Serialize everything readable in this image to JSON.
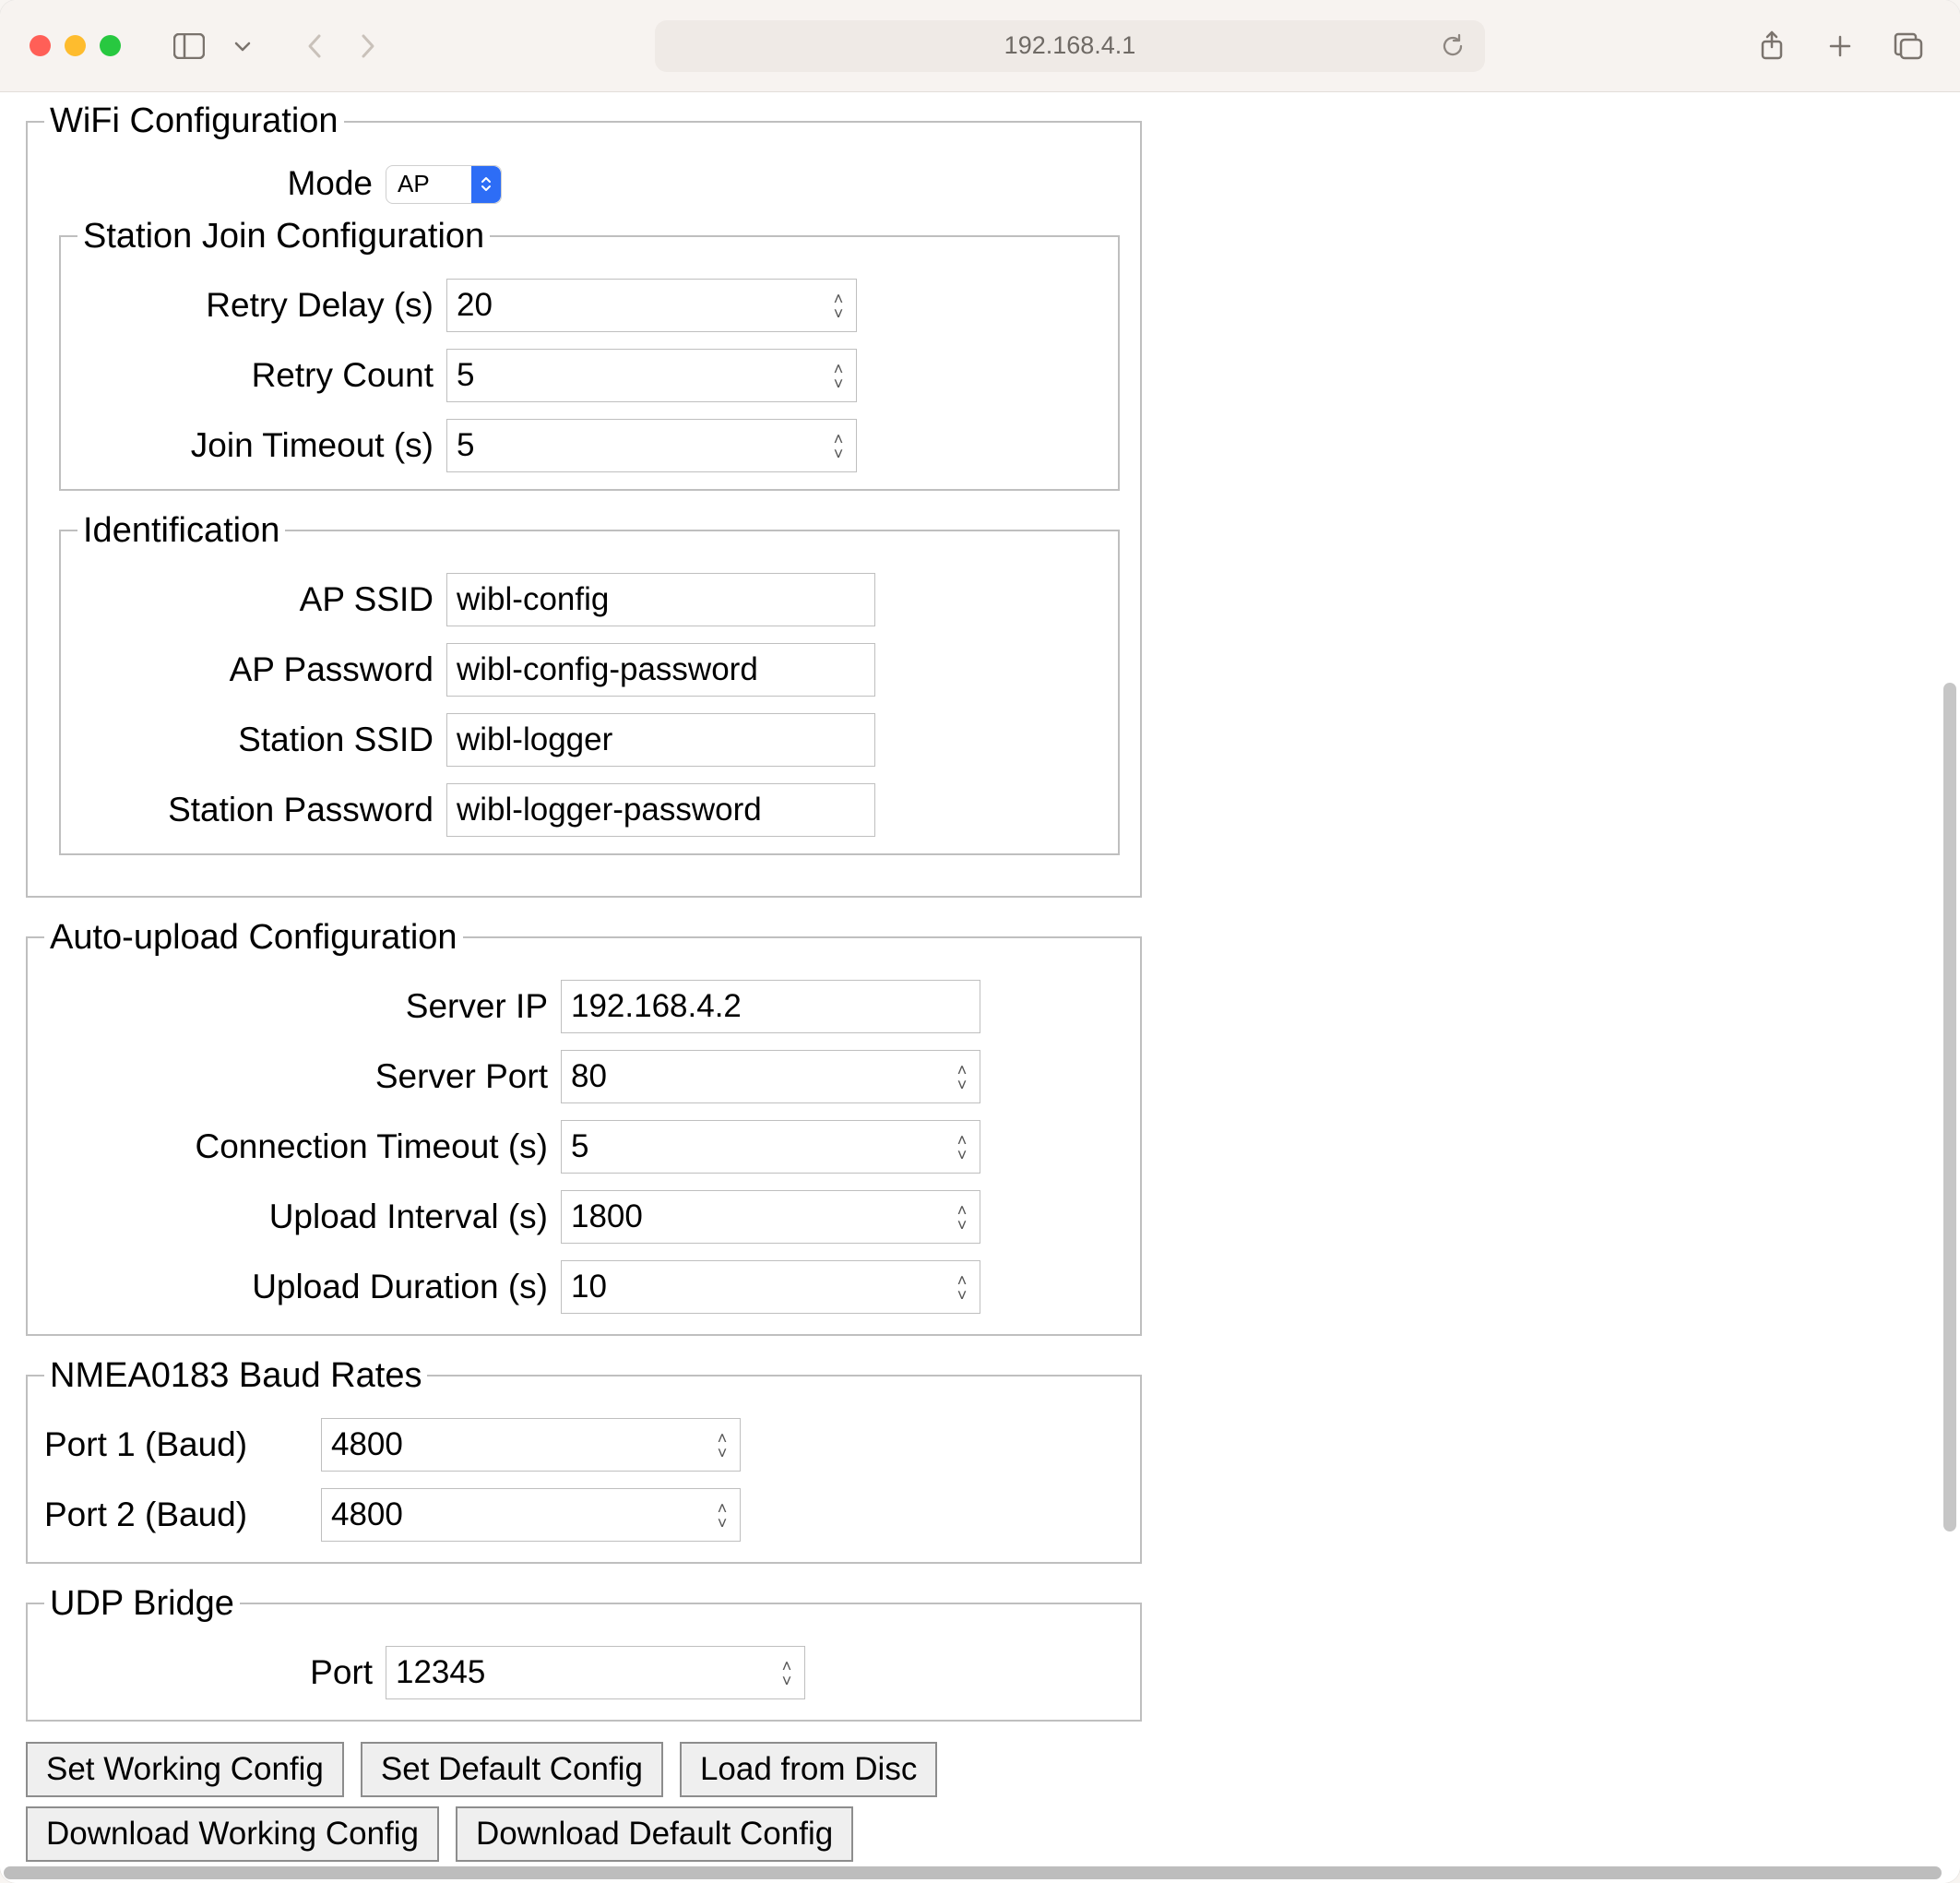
{
  "browser": {
    "url": "192.168.4.1"
  },
  "wifi": {
    "legend": "WiFi Configuration",
    "mode_label": "Mode",
    "mode_value": "AP",
    "station": {
      "legend": "Station Join Configuration",
      "retry_delay_label": "Retry Delay (s)",
      "retry_delay_value": "20",
      "retry_count_label": "Retry Count",
      "retry_count_value": "5",
      "join_timeout_label": "Join Timeout (s)",
      "join_timeout_value": "5"
    },
    "ident": {
      "legend": "Identification",
      "ap_ssid_label": "AP SSID",
      "ap_ssid_value": "wibl-config",
      "ap_pw_label": "AP Password",
      "ap_pw_value": "wibl-config-password",
      "sta_ssid_label": "Station SSID",
      "sta_ssid_value": "wibl-logger",
      "sta_pw_label": "Station Password",
      "sta_pw_value": "wibl-logger-password"
    }
  },
  "auto": {
    "legend": "Auto-upload Configuration",
    "server_ip_label": "Server IP",
    "server_ip_value": "192.168.4.2",
    "server_port_label": "Server Port",
    "server_port_value": "80",
    "conn_timeout_label": "Connection Timeout (s)",
    "conn_timeout_value": "5",
    "upload_interval_label": "Upload Interval (s)",
    "upload_interval_value": "1800",
    "upload_duration_label": "Upload Duration (s)",
    "upload_duration_value": "10"
  },
  "baud": {
    "legend": "NMEA0183 Baud Rates",
    "port1_label": "Port 1 (Baud)",
    "port1_value": "4800",
    "port2_label": "Port 2 (Baud)",
    "port2_value": "4800"
  },
  "udp": {
    "legend": "UDP Bridge",
    "port_label": "Port",
    "port_value": "12345"
  },
  "buttons": {
    "set_working": "Set Working Config",
    "set_default": "Set Default Config",
    "load_disc": "Load from Disc",
    "download_working": "Download Working Config",
    "download_default": "Download Default Config"
  }
}
